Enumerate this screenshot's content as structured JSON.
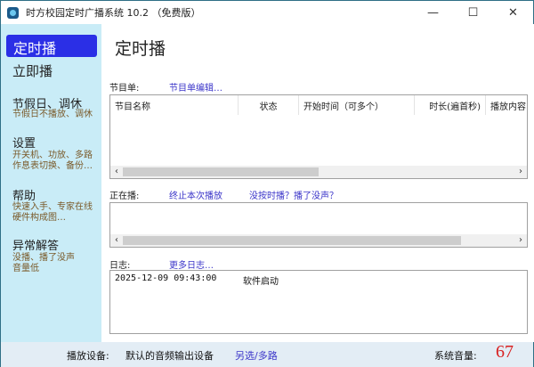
{
  "window": {
    "title": "时方校园定时广播系统 10.2 （免费版）",
    "minimize": "—",
    "maximize": "☐",
    "close": "✕"
  },
  "sidebar": {
    "items": [
      {
        "label": "定时播",
        "selected": true
      },
      {
        "label": "立即播"
      },
      {
        "label": "节假日、调休",
        "sub": [
          "节假日不播放、调休"
        ]
      },
      {
        "label": "设置",
        "sub": [
          "开关机、功放、多路",
          "作息表切换、备份…"
        ]
      },
      {
        "label": "帮助",
        "sub": [
          "快速入手、专家在线",
          "硬件构成图…"
        ]
      },
      {
        "label": "异常解答",
        "sub": [
          "没播、播了没声",
          "音量低"
        ]
      }
    ]
  },
  "main": {
    "title": "定时播",
    "program": {
      "label": "节目单:",
      "edit_link": "节目单编辑…",
      "columns": [
        "节目名称",
        "状态",
        "开始时间（可多个）",
        "时长(遍首秒)",
        "播放内容"
      ],
      "rows": []
    },
    "playing": {
      "label": "正在播:",
      "stop_link": "终止本次播放",
      "help_link": "没按时播？播了没声？"
    },
    "log": {
      "label": "日志:",
      "more_link": "更多日志…",
      "entries": [
        {
          "time": "2025-12-09 09:43:00",
          "message": "软件启动"
        }
      ]
    }
  },
  "bottom": {
    "device_label": "播放设备:",
    "device_value": "默认的音频输出设备",
    "device_link": "另选/多路",
    "volume_label": "系统音量:",
    "volume_value": "67"
  }
}
